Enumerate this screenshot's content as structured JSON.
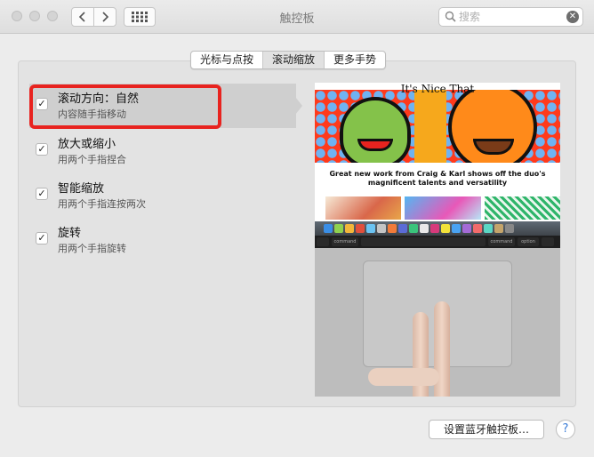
{
  "window": {
    "title": "触控板",
    "search_placeholder": "搜索"
  },
  "tabs": [
    {
      "label": "光标与点按",
      "active": false
    },
    {
      "label": "滚动缩放",
      "active": true
    },
    {
      "label": "更多手势",
      "active": false
    }
  ],
  "options": [
    {
      "label": "滚动方向：自然",
      "description": "内容随手指移动",
      "checked": true,
      "selected": true
    },
    {
      "label": "放大或缩小",
      "description": "用两个手指捏合",
      "checked": true,
      "selected": false
    },
    {
      "label": "智能缩放",
      "description": "用两个手指连按两次",
      "checked": true,
      "selected": false
    },
    {
      "label": "旋转",
      "description": "用两个手指旋转",
      "checked": true,
      "selected": false
    }
  ],
  "preview": {
    "site_title": "It's Nice That",
    "headline": "Great new work from Craig & Karl shows off the duo's magnificent talents and versatility",
    "keys": [
      "command",
      "command",
      "option"
    ]
  },
  "footer": {
    "bluetooth_button": "设置蓝牙触控板…",
    "help_label": "?"
  },
  "colors": {
    "highlight_border": "#e8231f",
    "selection_bg": "#cfcfcf",
    "active_tab_bg": "#e1e1e1"
  }
}
